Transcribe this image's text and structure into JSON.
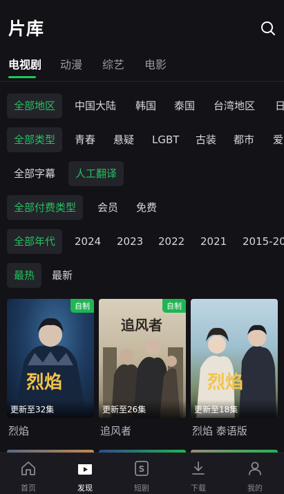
{
  "header": {
    "title": "片库"
  },
  "tabs": [
    "电视剧",
    "动漫",
    "综艺",
    "电影"
  ],
  "filters": {
    "region": [
      "全部地区",
      "中国大陆",
      "韩国",
      "泰国",
      "台湾地区",
      "日"
    ],
    "genre": [
      "全部类型",
      "青春",
      "悬疑",
      "LGBT",
      "古装",
      "都市",
      "爱"
    ],
    "subtitle": [
      "全部字幕",
      "人工翻译"
    ],
    "pay": [
      "全部付费类型",
      "会员",
      "免费"
    ],
    "year": [
      "全部年代",
      "2024",
      "2023",
      "2022",
      "2021",
      "2015-20"
    ],
    "sort": [
      "最热",
      "最新"
    ]
  },
  "cards": [
    {
      "title": "烈焰",
      "badge": "自制",
      "episodes": "更新至32集",
      "poster_text": "烈焰"
    },
    {
      "title": "追风者",
      "badge": "自制",
      "episodes": "更新至26集",
      "poster_text": "追风者"
    },
    {
      "title": "烈焰 泰语版",
      "badge": "",
      "episodes": "更新至18集",
      "poster_text": "烈焰"
    }
  ],
  "bottom_nav": [
    {
      "label": "首页",
      "icon": "home-icon",
      "active": false
    },
    {
      "label": "发现",
      "icon": "play-icon",
      "active": true
    },
    {
      "label": "短剧",
      "icon": "short-drama-icon",
      "active": false
    },
    {
      "label": "下载",
      "icon": "download-icon",
      "active": false
    },
    {
      "label": "我的",
      "icon": "profile-icon",
      "active": false
    }
  ],
  "colors": {
    "accent": "#22c35e",
    "background": "#121217"
  }
}
